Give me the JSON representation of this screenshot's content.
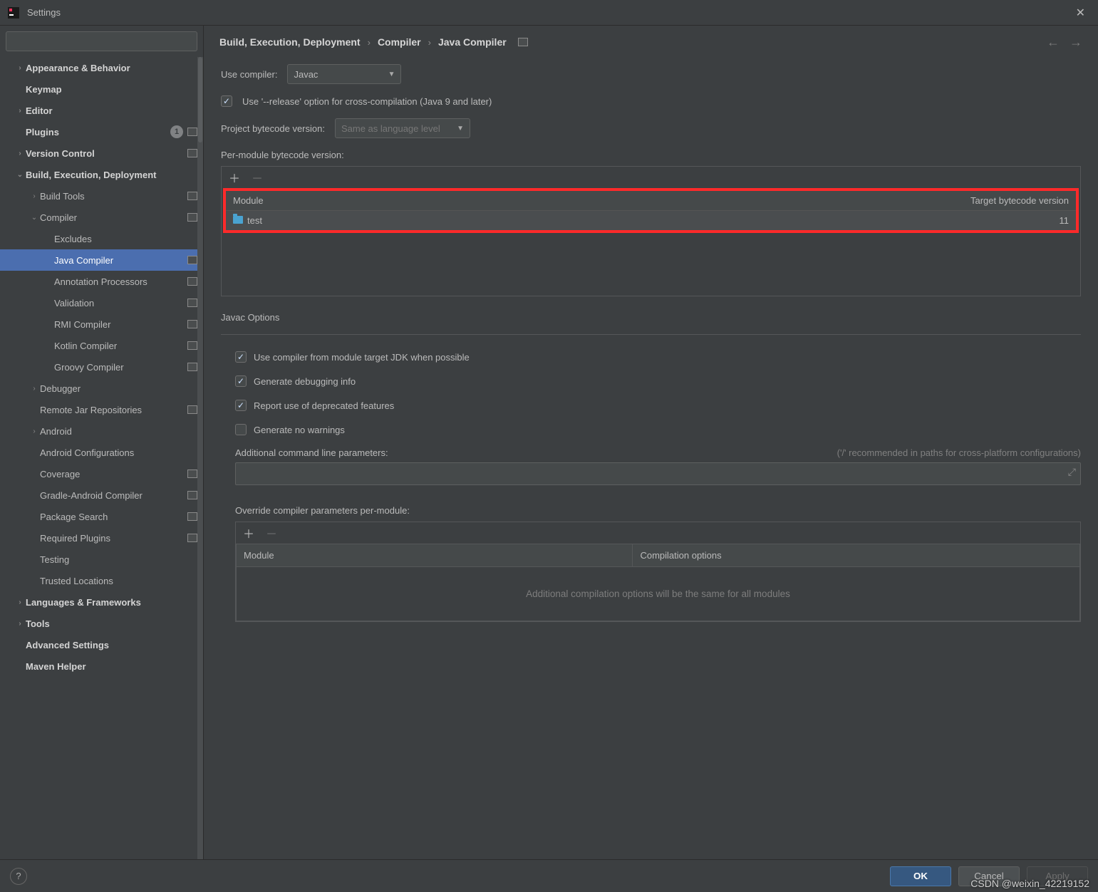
{
  "window": {
    "title": "Settings"
  },
  "sidebar": {
    "search_placeholder": "",
    "items": [
      {
        "label": "Appearance & Behavior",
        "chev": "›",
        "bold": true,
        "indent": 0
      },
      {
        "label": "Keymap",
        "chev": "",
        "bold": true,
        "indent": 0
      },
      {
        "label": "Editor",
        "chev": "›",
        "bold": true,
        "indent": 0
      },
      {
        "label": "Plugins",
        "chev": "",
        "bold": true,
        "indent": 0,
        "badge": "1",
        "rect": true
      },
      {
        "label": "Version Control",
        "chev": "›",
        "bold": true,
        "indent": 0,
        "rect": true
      },
      {
        "label": "Build, Execution, Deployment",
        "chev": "⌄",
        "bold": true,
        "indent": 0
      },
      {
        "label": "Build Tools",
        "chev": "›",
        "bold": false,
        "indent": 1,
        "rect": true
      },
      {
        "label": "Compiler",
        "chev": "⌄",
        "bold": false,
        "indent": 1,
        "rect": true
      },
      {
        "label": "Excludes",
        "chev": "",
        "bold": false,
        "indent": 2
      },
      {
        "label": "Java Compiler",
        "chev": "",
        "bold": false,
        "indent": 2,
        "rect": true,
        "selected": true
      },
      {
        "label": "Annotation Processors",
        "chev": "",
        "bold": false,
        "indent": 2,
        "rect": true
      },
      {
        "label": "Validation",
        "chev": "",
        "bold": false,
        "indent": 2,
        "rect": true
      },
      {
        "label": "RMI Compiler",
        "chev": "",
        "bold": false,
        "indent": 2,
        "rect": true
      },
      {
        "label": "Kotlin Compiler",
        "chev": "",
        "bold": false,
        "indent": 2,
        "rect": true
      },
      {
        "label": "Groovy Compiler",
        "chev": "",
        "bold": false,
        "indent": 2,
        "rect": true
      },
      {
        "label": "Debugger",
        "chev": "›",
        "bold": false,
        "indent": 1
      },
      {
        "label": "Remote Jar Repositories",
        "chev": "",
        "bold": false,
        "indent": 1,
        "rect": true
      },
      {
        "label": "Android",
        "chev": "›",
        "bold": false,
        "indent": 1
      },
      {
        "label": "Android Configurations",
        "chev": "",
        "bold": false,
        "indent": 1
      },
      {
        "label": "Coverage",
        "chev": "",
        "bold": false,
        "indent": 1,
        "rect": true
      },
      {
        "label": "Gradle-Android Compiler",
        "chev": "",
        "bold": false,
        "indent": 1,
        "rect": true
      },
      {
        "label": "Package Search",
        "chev": "",
        "bold": false,
        "indent": 1,
        "rect": true
      },
      {
        "label": "Required Plugins",
        "chev": "",
        "bold": false,
        "indent": 1,
        "rect": true
      },
      {
        "label": "Testing",
        "chev": "",
        "bold": false,
        "indent": 1
      },
      {
        "label": "Trusted Locations",
        "chev": "",
        "bold": false,
        "indent": 1
      },
      {
        "label": "Languages & Frameworks",
        "chev": "›",
        "bold": true,
        "indent": 0
      },
      {
        "label": "Tools",
        "chev": "›",
        "bold": true,
        "indent": 0
      },
      {
        "label": "Advanced Settings",
        "chev": "",
        "bold": true,
        "indent": 0
      },
      {
        "label": "Maven Helper",
        "chev": "",
        "bold": true,
        "indent": 0
      }
    ]
  },
  "breadcrumb": {
    "a": "Build, Execution, Deployment",
    "b": "Compiler",
    "c": "Java Compiler"
  },
  "main": {
    "use_compiler_label": "Use compiler:",
    "use_compiler_value": "Javac",
    "release_checkbox": "Use '--release' option for cross-compilation (Java 9 and later)",
    "project_bytecode_label": "Project bytecode version:",
    "project_bytecode_placeholder": "Same as language level",
    "per_module_label": "Per-module bytecode version:",
    "module_col": "Module",
    "target_col": "Target bytecode version",
    "module_row": {
      "name": "test",
      "target": "11"
    },
    "javac_options_title": "Javac Options",
    "opt1": "Use compiler from module target JDK when possible",
    "opt2": "Generate debugging info",
    "opt3": "Report use of deprecated features",
    "opt4": "Generate no warnings",
    "addl_params_label": "Additional command line parameters:",
    "addl_hint": "('/' recommended in paths for cross-platform configurations)",
    "override_title": "Override compiler parameters per-module:",
    "override_col_module": "Module",
    "override_col_opts": "Compilation options",
    "override_empty": "Additional compilation options will be the same for all modules"
  },
  "footer": {
    "ok": "OK",
    "cancel": "Cancel",
    "apply": "Apply"
  },
  "watermark": "CSDN @weixin_42219152"
}
